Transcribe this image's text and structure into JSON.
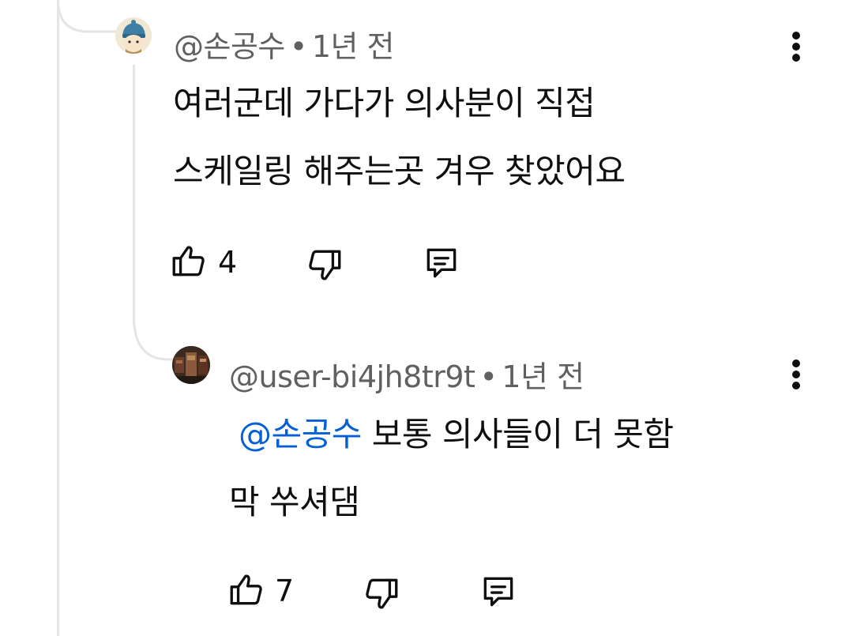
{
  "comments": [
    {
      "author": "@손공수",
      "time": "1년 전",
      "separator": "•",
      "text_lines": [
        "여러군데 가다가 의사분이 직접",
        "스케일링 해주는곳 겨우 찾았어요"
      ],
      "like_count": "4"
    },
    {
      "author": "@user-bi4jh8tr9t",
      "time": "1년 전",
      "separator": "•",
      "mention": "@손공수",
      "text_line1_rest": " 보통 의사들이 더 못함",
      "text_line2": "막 쑤셔댐",
      "like_count": "7"
    }
  ],
  "icons": {
    "like": "thumb-up-icon",
    "dislike": "thumb-down-icon",
    "reply": "comment-icon",
    "more": "more-vertical-icon"
  },
  "colors": {
    "text": "#0f0f0f",
    "meta": "#606060",
    "mention": "#065fd4",
    "thread_line": "#e5e5e5"
  }
}
